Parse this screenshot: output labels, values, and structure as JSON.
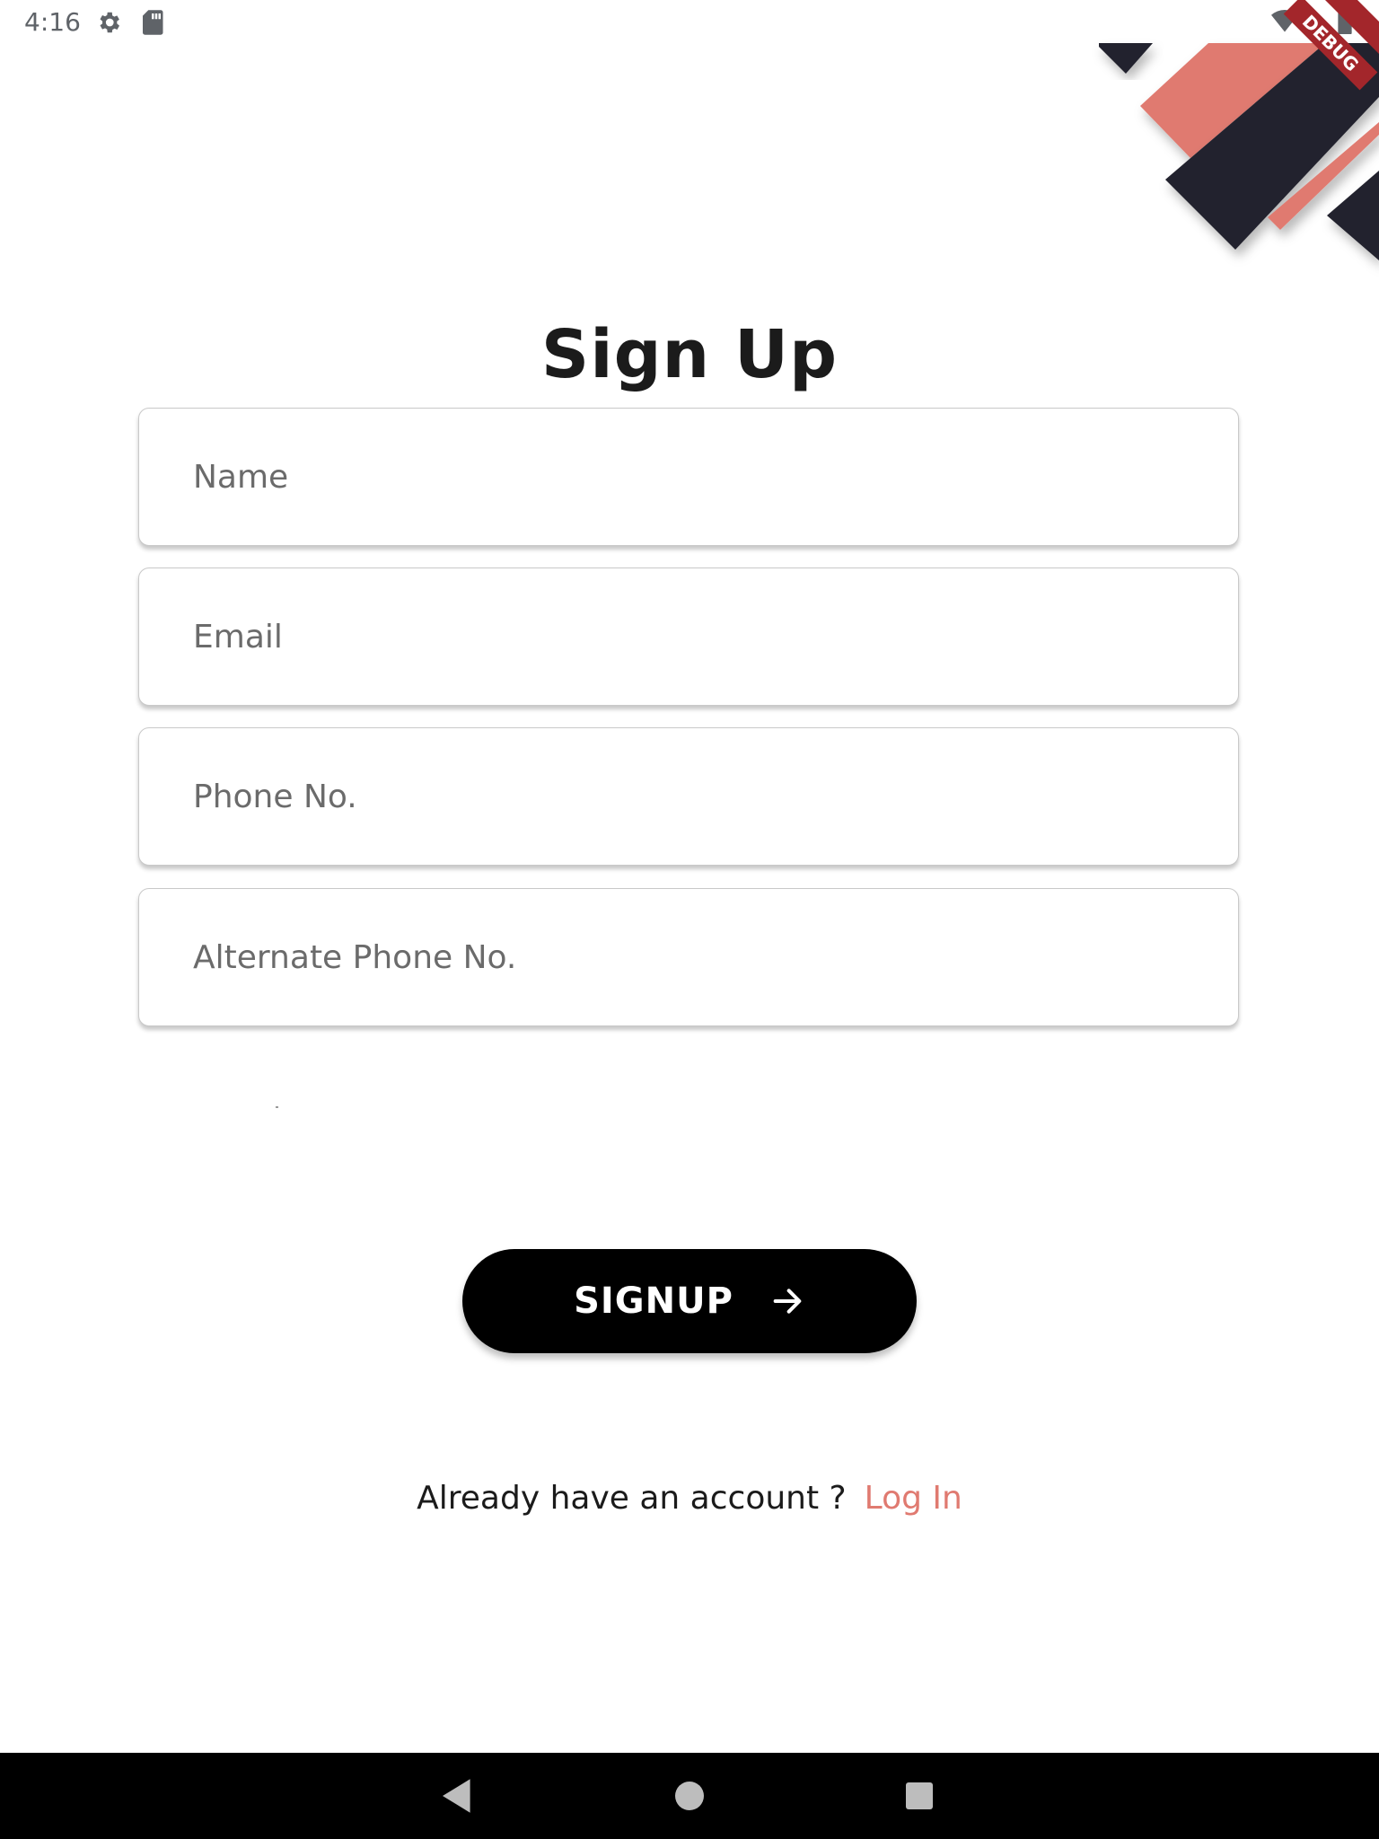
{
  "status_bar": {
    "time": "4:16",
    "icons": [
      "settings-icon",
      "sd-card-icon",
      "wifi-icon",
      "battery-icon"
    ]
  },
  "debug_banner": {
    "label": "DEBUG"
  },
  "page": {
    "title": "Sign Up"
  },
  "form": {
    "fields": [
      {
        "placeholder": "Name",
        "value": ""
      },
      {
        "placeholder": "Email",
        "value": ""
      },
      {
        "placeholder": "Phone No.",
        "value": ""
      },
      {
        "placeholder": "Alternate Phone No.",
        "value": ""
      }
    ],
    "submit_label": "SIGNUP",
    "submit_icon": "arrow-right-icon"
  },
  "login": {
    "prompt": "Already have an account ?",
    "link_label": "Log In"
  },
  "nav_bar": {
    "buttons": [
      "back-icon",
      "home-icon",
      "recents-icon"
    ]
  },
  "colors": {
    "accent": "#e07a70",
    "dark": "#23232e",
    "button_bg": "#000000",
    "text": "#1b1b1b"
  }
}
